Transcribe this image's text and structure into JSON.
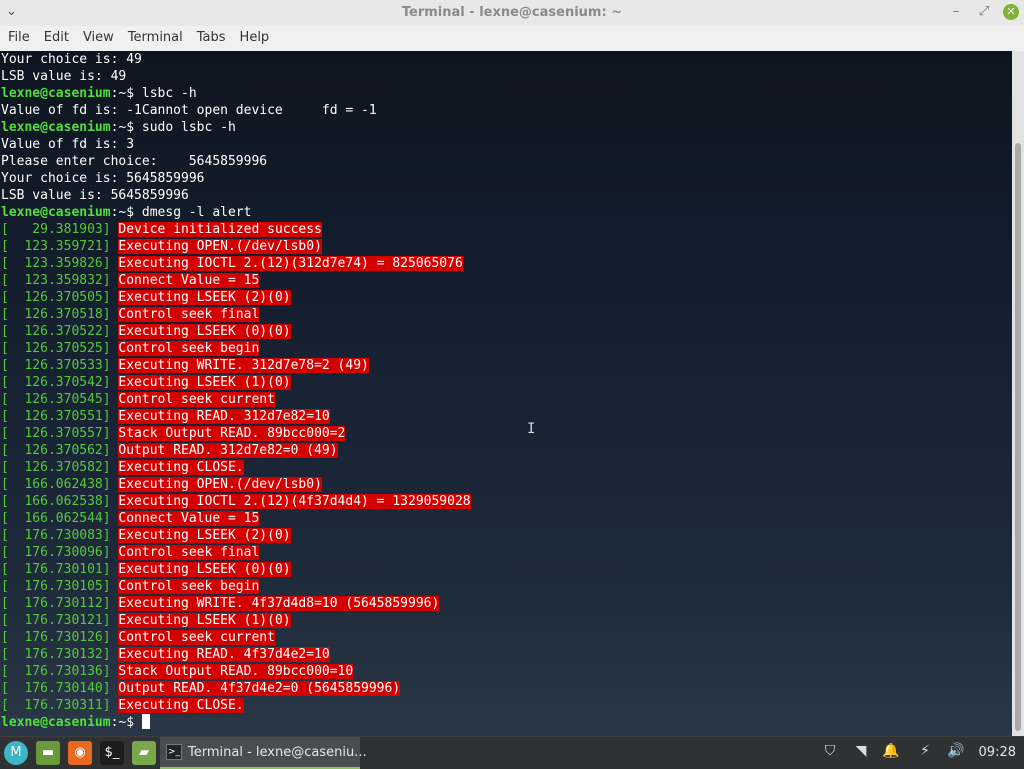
{
  "window": {
    "title": "Terminal - lexne@casenium: ~",
    "menu_glyph": "⌄",
    "min_glyph": "–",
    "max_glyph": "⤢",
    "close_glyph": "✕"
  },
  "menu": [
    "File",
    "Edit",
    "View",
    "Terminal",
    "Tabs",
    "Help"
  ],
  "prompt": "lexne@casenium",
  "prompt_suffix": ":~$ ",
  "output_top": [
    {
      "kind": "text",
      "text": "Your choice is: 49"
    },
    {
      "kind": "text",
      "text": "LSB value is: 49"
    },
    {
      "kind": "cmd",
      "text": "lsbc -h"
    },
    {
      "kind": "text",
      "text": "Value of fd is: -1Cannot open device     fd = -1"
    },
    {
      "kind": "cmd",
      "text": "sudo lsbc -h"
    },
    {
      "kind": "text",
      "text": "Value of fd is: 3"
    },
    {
      "kind": "text",
      "text": "Please enter choice:    5645859996"
    },
    {
      "kind": "text",
      "text": "Your choice is: 5645859996"
    },
    {
      "kind": "text",
      "text": "LSB value is: 5645859996"
    },
    {
      "kind": "cmd",
      "text": "dmesg -l alert"
    }
  ],
  "dmesg": [
    {
      "ts": "[   29.381903] ",
      "msg": "Device initialized success"
    },
    {
      "ts": "[  123.359721] ",
      "msg": "Executing OPEN.(/dev/lsb0)"
    },
    {
      "ts": "[  123.359826] ",
      "msg": "Executing IOCTL 2.(12)(312d7e74) = 825065076"
    },
    {
      "ts": "[  123.359832] ",
      "msg": "Connect Value = 15"
    },
    {
      "ts": "[  126.370505] ",
      "msg": "Executing LSEEK (2)(0)"
    },
    {
      "ts": "[  126.370518] ",
      "msg": "Control seek final"
    },
    {
      "ts": "[  126.370522] ",
      "msg": "Executing LSEEK (0)(0)"
    },
    {
      "ts": "[  126.370525] ",
      "msg": "Control seek begin"
    },
    {
      "ts": "[  126.370533] ",
      "msg": "Executing WRITE. 312d7e78=2 (49)"
    },
    {
      "ts": "[  126.370542] ",
      "msg": "Executing LSEEK (1)(0)"
    },
    {
      "ts": "[  126.370545] ",
      "msg": "Control seek current"
    },
    {
      "ts": "[  126.370551] ",
      "msg": "Executing READ. 312d7e82=10"
    },
    {
      "ts": "[  126.370557] ",
      "msg": "Stack Output READ. 89bcc000=2"
    },
    {
      "ts": "[  126.370562] ",
      "msg": "Output READ. 312d7e82=0 (49)"
    },
    {
      "ts": "[  126.370582] ",
      "msg": "Executing CLOSE."
    },
    {
      "ts": "[  166.062438] ",
      "msg": "Executing OPEN.(/dev/lsb0)"
    },
    {
      "ts": "[  166.062538] ",
      "msg": "Executing IOCTL 2.(12)(4f37d4d4) = 1329059028"
    },
    {
      "ts": "[  166.062544] ",
      "msg": "Connect Value = 15"
    },
    {
      "ts": "[  176.730083] ",
      "msg": "Executing LSEEK (2)(0)"
    },
    {
      "ts": "[  176.730096] ",
      "msg": "Control seek final"
    },
    {
      "ts": "[  176.730101] ",
      "msg": "Executing LSEEK (0)(0)"
    },
    {
      "ts": "[  176.730105] ",
      "msg": "Control seek begin"
    },
    {
      "ts": "[  176.730112] ",
      "msg": "Executing WRITE. 4f37d4d8=10 (5645859996)"
    },
    {
      "ts": "[  176.730121] ",
      "msg": "Executing LSEEK (1)(0)"
    },
    {
      "ts": "[  176.730126] ",
      "msg": "Control seek current"
    },
    {
      "ts": "[  176.730132] ",
      "msg": "Executing READ. 4f37d4e2=10"
    },
    {
      "ts": "[  176.730136] ",
      "msg": "Stack Output READ. 89bcc000=10"
    },
    {
      "ts": "[  176.730140] ",
      "msg": "Output READ. 4f37d4e2=0 (5645859996)"
    },
    {
      "ts": "[  176.730311] ",
      "msg": "Executing CLOSE."
    }
  ],
  "taskbar": {
    "launchers": [
      {
        "name": "mint-menu-icon",
        "glyph": "M",
        "color": "#3cb5c7"
      },
      {
        "name": "show-desktop-icon",
        "glyph": "▬",
        "color": "#6a9a3a"
      },
      {
        "name": "firefox-icon",
        "glyph": "◉",
        "color": "#e66a1f"
      },
      {
        "name": "terminal-launcher-icon",
        "glyph": "$_",
        "color": "#1d1d1d"
      },
      {
        "name": "files-icon",
        "glyph": "▰",
        "color": "#7ba84a"
      }
    ],
    "task_label": "Terminal - lexne@caseniu...",
    "task_icon_glyph": ">_",
    "tray": [
      {
        "name": "shield-icon",
        "glyph": "⛉"
      },
      {
        "name": "wifi-icon",
        "glyph": "◥"
      },
      {
        "name": "notifications-bell-icon",
        "glyph": "🔔"
      },
      {
        "name": "power-icon",
        "glyph": "⚡"
      },
      {
        "name": "volume-icon",
        "glyph": "🔊"
      }
    ],
    "clock": "09:28"
  },
  "colors": {
    "prompt": "#4fe03e",
    "timestamp": "#56c93b",
    "alert_bg": "#d40000",
    "titlebar_close": "#7fb239"
  }
}
